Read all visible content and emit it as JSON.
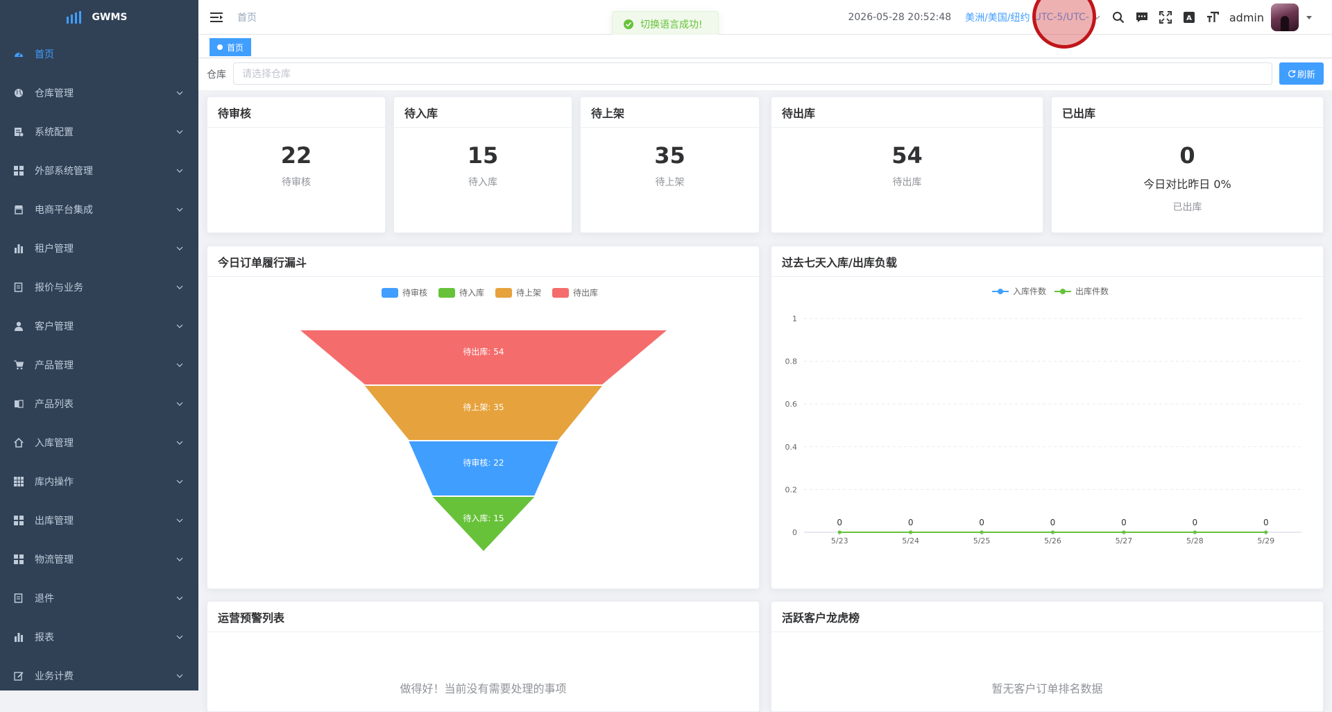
{
  "app": {
    "logo_text": "GWMS"
  },
  "sidebar": {
    "items": [
      {
        "label": "首页",
        "icon": "dashboard-icon",
        "active": true
      },
      {
        "label": "仓库管理",
        "icon": "globe-icon"
      },
      {
        "label": "系统配置",
        "icon": "config-icon"
      },
      {
        "label": "外部系统管理",
        "icon": "grid-icon"
      },
      {
        "label": "电商平台集成",
        "icon": "shop-icon"
      },
      {
        "label": "租户管理",
        "icon": "bar-chart-icon"
      },
      {
        "label": "报价与业务",
        "icon": "document-icon"
      },
      {
        "label": "客户管理",
        "icon": "user-icon"
      },
      {
        "label": "产品管理",
        "icon": "cart-icon"
      },
      {
        "label": "产品列表",
        "icon": "book-icon"
      },
      {
        "label": "入库管理",
        "icon": "home-icon"
      },
      {
        "label": "库内操作",
        "icon": "table-icon"
      },
      {
        "label": "出库管理",
        "icon": "grid-icon"
      },
      {
        "label": "物流管理",
        "icon": "grid-icon"
      },
      {
        "label": "退件",
        "icon": "document-icon"
      },
      {
        "label": "报表",
        "icon": "bar-chart-icon"
      },
      {
        "label": "业务计费",
        "icon": "edit-icon"
      }
    ]
  },
  "topbar": {
    "breadcrumb": "首页",
    "datetime": "2026-05-28 20:52:48",
    "timezone": "美洲/美国/纽约",
    "timezone_suffix": "UTC-5/UTC-",
    "username": "admin"
  },
  "toast": {
    "message": "切换语言成功!"
  },
  "tags": {
    "active_tag": "首页"
  },
  "filter": {
    "label": "仓库",
    "placeholder": "请选择仓库",
    "refresh_label": "刷新"
  },
  "stats": [
    {
      "title": "待审核",
      "value": "22",
      "sub": "待审核"
    },
    {
      "title": "待入库",
      "value": "15",
      "sub": "待入库"
    },
    {
      "title": "待上架",
      "value": "35",
      "sub": "待上架"
    },
    {
      "title": "待出库",
      "value": "54",
      "sub": "待出库"
    },
    {
      "title": "已出库",
      "value": "0",
      "compare": "今日对比昨日 0%",
      "sub": "已出库"
    }
  ],
  "panels": {
    "funnel_title": "今日订单履行漏斗",
    "load_title": "过去七天入库/出库负载",
    "alerts_title": "运营预警列表",
    "alerts_empty": "做得好！当前没有需要处理的事项",
    "ranking_title": "活跃客户龙虎榜",
    "ranking_empty": "暂无客户订单排名数据"
  },
  "chart_data": [
    {
      "type": "funnel",
      "legend": [
        "待审核",
        "待入库",
        "待上架",
        "待出库"
      ],
      "colors": {
        "待审核": "#409eff",
        "待入库": "#67c23a",
        "待上架": "#e6a23c",
        "待出库": "#f56c6c"
      },
      "stages": [
        {
          "name": "待出库",
          "value": 54
        },
        {
          "name": "待上架",
          "value": 35
        },
        {
          "name": "待审核",
          "value": 22
        },
        {
          "name": "待入库",
          "value": 15
        }
      ],
      "label_format": "{name}: {value}"
    },
    {
      "type": "line",
      "categories": [
        "5/23",
        "5/24",
        "5/25",
        "5/26",
        "5/27",
        "5/28",
        "5/29"
      ],
      "series": [
        {
          "name": "入库件数",
          "values": [
            0,
            0,
            0,
            0,
            0,
            0,
            0
          ],
          "color": "#409eff"
        },
        {
          "name": "出库件数",
          "values": [
            0,
            0,
            0,
            0,
            0,
            0,
            0
          ],
          "color": "#67c23a"
        }
      ],
      "point_labels": [
        "0",
        "0",
        "0",
        "0",
        "0",
        "0",
        "0"
      ],
      "ylim": [
        0,
        1
      ],
      "yticks": [
        "0",
        "0.2",
        "0.4",
        "0.6",
        "0.8",
        "1"
      ],
      "legend_position": "top-center",
      "grid": true
    }
  ]
}
